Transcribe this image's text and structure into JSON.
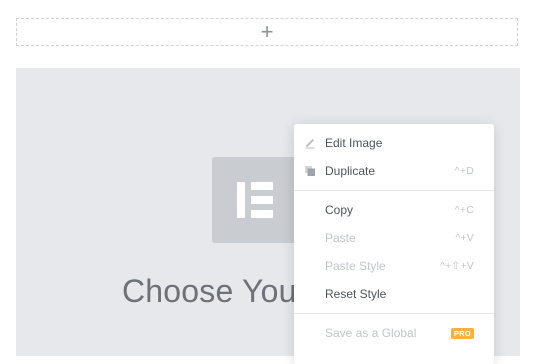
{
  "add_section": {
    "icon": "plus-icon",
    "glyph": "+"
  },
  "widget": {
    "icon": "elementor-logo-icon",
    "title": "Choose Your"
  },
  "context_menu": {
    "groups": [
      {
        "items": [
          {
            "id": "edit-image",
            "icon": "pencil-icon",
            "label": "Edit Image",
            "shortcut": "",
            "disabled": false
          },
          {
            "id": "duplicate",
            "icon": "copy-icon",
            "label": "Duplicate",
            "shortcut": "^+D",
            "disabled": false
          }
        ]
      },
      {
        "items": [
          {
            "id": "copy",
            "icon": "",
            "label": "Copy",
            "shortcut": "^+C",
            "disabled": false
          },
          {
            "id": "paste",
            "icon": "",
            "label": "Paste",
            "shortcut": "^+V",
            "disabled": true
          },
          {
            "id": "paste-style",
            "icon": "",
            "label": "Paste Style",
            "shortcut": "^+⇧+V",
            "disabled": true
          },
          {
            "id": "reset-style",
            "icon": "",
            "label": "Reset Style",
            "shortcut": "",
            "disabled": false
          }
        ]
      },
      {
        "items": [
          {
            "id": "save-as-global",
            "icon": "",
            "label": "Save as a Global",
            "badge": "PRO",
            "disabled": true
          }
        ]
      }
    ]
  },
  "colors": {
    "canvas_bg": "#e6e8eb",
    "placeholder_icon_bg": "#c9ccd0",
    "pro_badge": "#f7b23b",
    "menu_text": "#4f555b",
    "menu_text_disabled": "#c1c6cb"
  }
}
